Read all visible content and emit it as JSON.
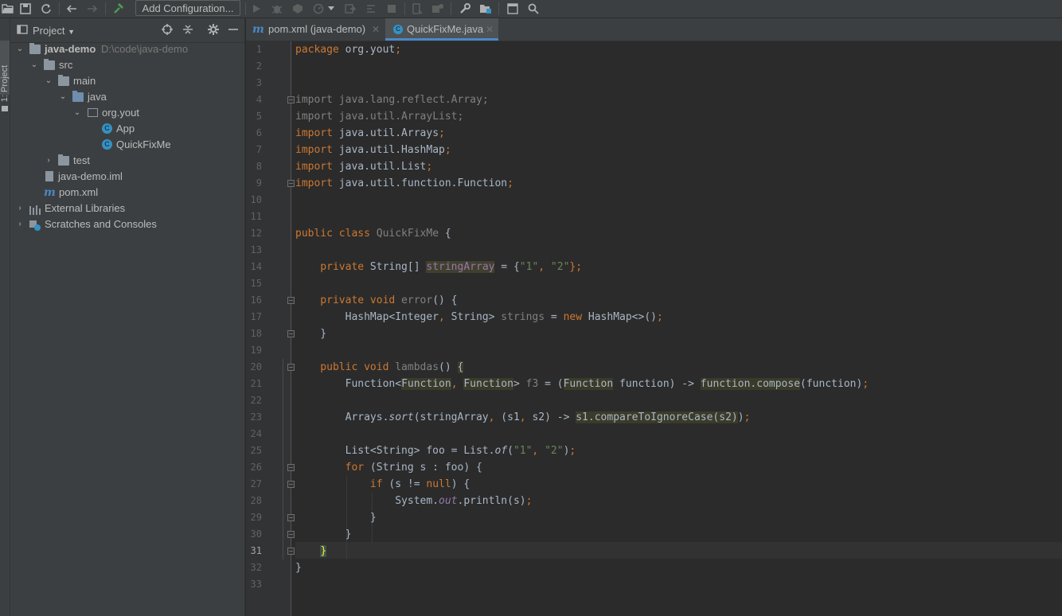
{
  "toolbar": {
    "add_config_label": "Add Configuration...",
    "icons": [
      "open-folder-icon",
      "save-icon",
      "sync-icon",
      "back-icon",
      "forward-icon",
      "build-icon",
      "run-icon",
      "debug-icon",
      "coverage-icon",
      "profile-icon",
      "dropdown-icon",
      "attach-icon",
      "stop-icon",
      "layout-icon",
      "device-icon",
      "settings-icon",
      "project-structure-icon",
      "frame-icon",
      "search-icon"
    ]
  },
  "side_stripe": {
    "label": "1: Project"
  },
  "project_panel": {
    "title": "Project",
    "tree": [
      {
        "label": "java-demo",
        "path": "D:\\code\\java-demo",
        "depth": 0,
        "expanded": true,
        "icon": "module-folder",
        "bold": true
      },
      {
        "label": "src",
        "depth": 1,
        "expanded": true,
        "icon": "folder"
      },
      {
        "label": "main",
        "depth": 2,
        "expanded": true,
        "icon": "folder"
      },
      {
        "label": "java",
        "depth": 3,
        "expanded": true,
        "icon": "source-folder"
      },
      {
        "label": "org.yout",
        "depth": 4,
        "expanded": true,
        "icon": "package"
      },
      {
        "label": "App",
        "depth": 5,
        "icon": "class"
      },
      {
        "label": "QuickFixMe",
        "depth": 5,
        "icon": "class"
      },
      {
        "label": "test",
        "depth": 2,
        "expanded": false,
        "icon": "folder"
      },
      {
        "label": "java-demo.iml",
        "depth": 2,
        "icon": "iml-file"
      },
      {
        "label": "pom.xml",
        "depth": 2,
        "icon": "maven-file"
      },
      {
        "label": "External Libraries",
        "depth": 0,
        "expanded": false,
        "icon": "libraries"
      },
      {
        "label": "Scratches and Consoles",
        "depth": 0,
        "expanded": false,
        "icon": "scratches"
      }
    ]
  },
  "tabs": [
    {
      "label": "pom.xml (java-demo)",
      "icon": "maven-icon",
      "active": false
    },
    {
      "label": "QuickFixMe.java",
      "icon": "class-icon",
      "active": true
    }
  ],
  "editor": {
    "current_line": 31,
    "line_numbers": [
      "1",
      "2",
      "3",
      "4",
      "5",
      "6",
      "7",
      "8",
      "9",
      "10",
      "11",
      "12",
      "13",
      "14",
      "15",
      "16",
      "17",
      "18",
      "19",
      "20",
      "21",
      "22",
      "23",
      "24",
      "25",
      "26",
      "27",
      "28",
      "29",
      "30",
      "31",
      "32",
      "33"
    ],
    "code": {
      "l1_a": "package",
      "l1_b": " org.yout",
      "l1_c": ";",
      "l4_a": "import",
      "l4_b": " java.lang.reflect.Array",
      "l4_c": ";",
      "l5_a": "import",
      "l5_b": " java.util.ArrayList",
      "l5_c": ";",
      "l6_a": "import",
      "l6_b": " java.util.Arrays",
      "l6_c": ";",
      "l7_a": "import",
      "l7_b": " java.util.HashMap",
      "l7_c": ";",
      "l8_a": "import",
      "l8_b": " java.util.List",
      "l8_c": ";",
      "l9_a": "import",
      "l9_b": " java.util.function.Function",
      "l9_c": ";",
      "l12_a": "public class",
      "l12_b": " QuickFixMe",
      "l12_c": " {",
      "l14_a": "    private",
      "l14_b": " String[] ",
      "l14_c": "stringArray",
      "l14_d": " = {",
      "l14_e": "\"1\"",
      "l14_f": ", ",
      "l14_g": "\"2\"",
      "l14_h": "};",
      "l16_a": "    private void",
      "l16_b": " error",
      "l16_c": "() {",
      "l17_a": "        HashMap<Integer",
      "l17_b": ", ",
      "l17_c": "String> ",
      "l17_d": "strings",
      "l17_e": " = ",
      "l17_f": "new",
      "l17_g": " HashMap<>()",
      "l17_h": ";",
      "l18_a": "    }",
      "l20_a": "    public void",
      "l20_b": " lambdas",
      "l20_c": "() ",
      "l20_d": "{",
      "l21_a": "        Function<",
      "l21_b": "Function",
      "l21_c": ", ",
      "l21_d": "Function",
      "l21_e": "> ",
      "l21_f": "f3",
      "l21_g": " = (",
      "l21_h": "Function",
      "l21_i": " function) -> ",
      "l21_j": "function.compose",
      "l21_k": "(function)",
      "l21_l": ";",
      "l23_a": "        Arrays.",
      "l23_b": "sort",
      "l23_c": "(stringArray",
      "l23_d": ", ",
      "l23_e": "(s1",
      "l23_f": ", ",
      "l23_g": "s2) -> ",
      "l23_h": "s1.compareToIgnoreCase(s2)",
      "l23_i": ")",
      "l23_j": ";",
      "l25_a": "        List<String> foo = List.",
      "l25_b": "of",
      "l25_c": "(",
      "l25_d": "\"1\"",
      "l25_e": ", ",
      "l25_f": "\"2\"",
      "l25_g": ")",
      "l25_h": ";",
      "l26_a": "        for",
      "l26_b": " (String s : foo) {",
      "l27_a": "            if",
      "l27_b": " (s != ",
      "l27_c": "null",
      "l27_d": ") {",
      "l28_a": "                System.",
      "l28_b": "out",
      "l28_c": ".println(s)",
      "l28_d": ";",
      "l29_a": "            }",
      "l30_a": "        }",
      "l31_a": "    ",
      "l31_b": "}",
      "l32_a": "}"
    }
  },
  "colors": {
    "keyword": "#CC7832",
    "string": "#6A8759",
    "field": "#9876AA",
    "text": "#A9B7C6",
    "comment_gray": "#808080",
    "accent": "#4A88C7"
  }
}
